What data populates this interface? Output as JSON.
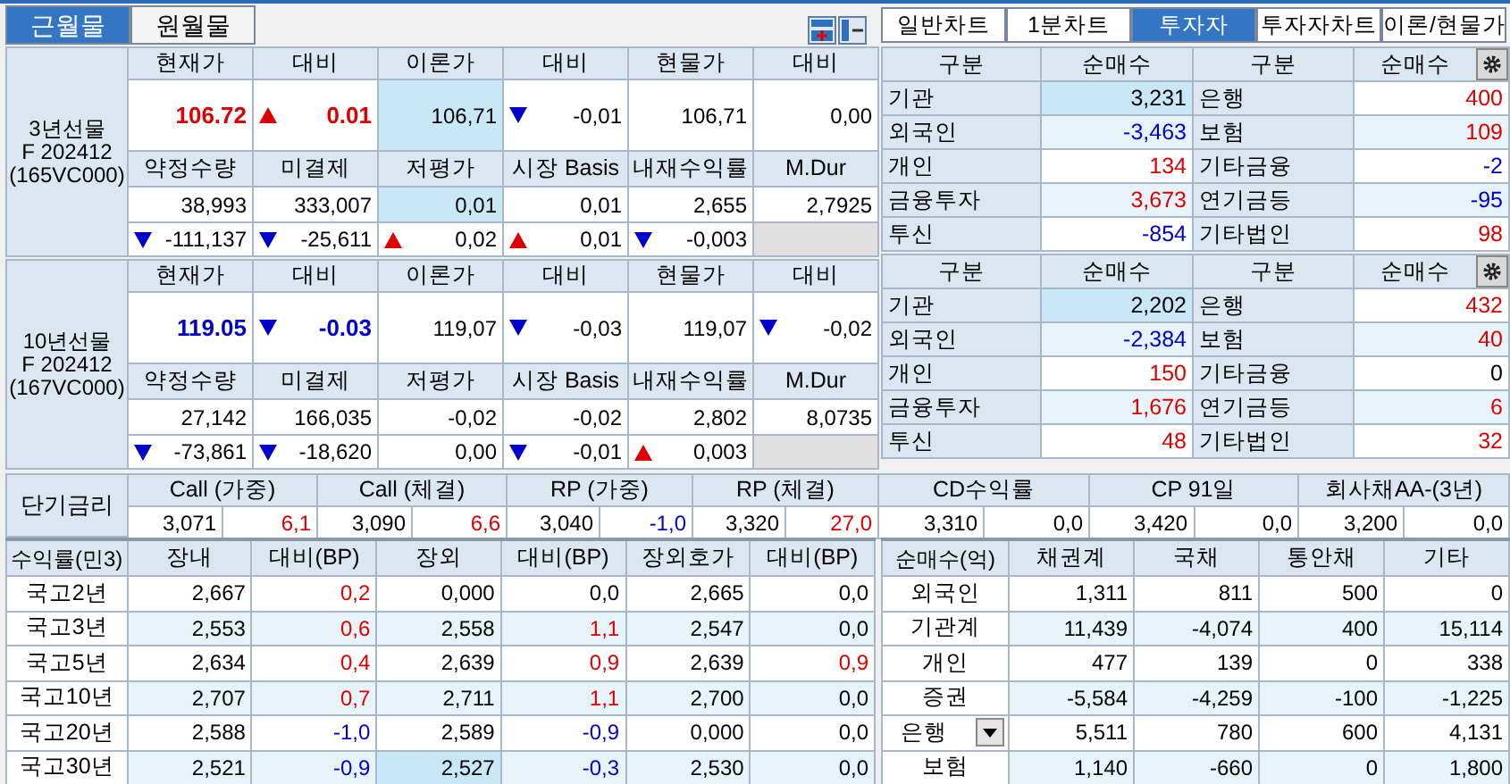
{
  "month_tabs": [
    {
      "label": "근월물",
      "selected": true
    },
    {
      "label": "원월물",
      "selected": false
    }
  ],
  "chart_tabs": [
    {
      "label": "일반차트",
      "selected": false
    },
    {
      "label": "1분차트",
      "selected": false
    },
    {
      "label": "투자자",
      "selected": true
    },
    {
      "label": "투자자차트",
      "selected": false
    },
    {
      "label": "이론/현물가",
      "selected": false
    }
  ],
  "futures": [
    {
      "name_lines": [
        "3년선물",
        "F 202412",
        "(165VC000)"
      ],
      "header1": [
        "현재가",
        "대비",
        "이론가",
        "대비",
        "현물가",
        "대비"
      ],
      "row1": [
        {
          "text": "106.72",
          "color": "#dd0000",
          "bold": true
        },
        {
          "text": "0.01",
          "color": "#dd0000",
          "bold": true,
          "rising": true
        },
        {
          "text": "106,71",
          "highlighted": true
        },
        {
          "text": "-0,01",
          "rising": false
        },
        {
          "text": "106,71"
        },
        {
          "text": "0,00"
        }
      ],
      "header2": [
        "약정수량",
        "미결제",
        "저평가",
        "시장 Basis",
        "내재수익률",
        "M.Dur"
      ],
      "row2": [
        {
          "text": "38,993"
        },
        {
          "text": "333,007"
        },
        {
          "text": "0,01",
          "highlighted": true
        },
        {
          "text": "0,01"
        },
        {
          "text": "2,655"
        },
        {
          "text": "2,7925"
        }
      ],
      "row3": [
        {
          "text": "-111,137",
          "rising": false
        },
        {
          "text": "-25,611",
          "rising": false
        },
        {
          "text": "0,02",
          "rising": true
        },
        {
          "text": "0,01",
          "rising": true
        },
        {
          "text": "-0,003",
          "rising": false
        }
      ]
    },
    {
      "name_lines": [
        "10년선물",
        "F 202412",
        "(167VC000)"
      ],
      "header1": [
        "현재가",
        "대비",
        "이론가",
        "대비",
        "현물가",
        "대비"
      ],
      "row1": [
        {
          "text": "119.05",
          "color": "#0000cc",
          "bold": true
        },
        {
          "text": "-0.03",
          "color": "#0000cc",
          "bold": true,
          "rising": false
        },
        {
          "text": "119,07"
        },
        {
          "text": "-0,03",
          "rising": false
        },
        {
          "text": "119,07"
        },
        {
          "text": "-0,02",
          "rising": false
        }
      ],
      "header2": [
        "약정수량",
        "미결제",
        "저평가",
        "시장 Basis",
        "내재수익률",
        "M.Dur"
      ],
      "row2": [
        {
          "text": "27,142"
        },
        {
          "text": "166,035"
        },
        {
          "text": "-0,02"
        },
        {
          "text": "-0,02"
        },
        {
          "text": "2,802"
        },
        {
          "text": "8,0735"
        }
      ],
      "row3": [
        {
          "text": "-73,861",
          "rising": false
        },
        {
          "text": "-18,620",
          "rising": false
        },
        {
          "text": "0,00"
        },
        {
          "text": "-0,01",
          "rising": false
        },
        {
          "text": "0,003",
          "rising": true
        }
      ]
    }
  ],
  "investor_tables": [
    {
      "headers": [
        "구분",
        "순매수",
        "구분",
        "순매수"
      ],
      "rows": [
        [
          {
            "label": "기관",
            "value": "3,231",
            "highlighted": true
          },
          {
            "label": "은행",
            "value": "400",
            "color": "#dd0000"
          }
        ],
        [
          {
            "label": "외국인",
            "value": "-3,463",
            "color": "#0000cc"
          },
          {
            "label": "보험",
            "value": "109",
            "color": "#dd0000"
          }
        ],
        [
          {
            "label": "개인",
            "value": "134",
            "color": "#dd0000"
          },
          {
            "label": "기타금융",
            "value": "-2",
            "color": "#0000cc"
          }
        ],
        [
          {
            "label": "금융투자",
            "value": "3,673",
            "color": "#dd0000"
          },
          {
            "label": "연기금등",
            "value": "-95",
            "color": "#0000cc"
          }
        ],
        [
          {
            "label": "투신",
            "value": "-854",
            "color": "#0000cc"
          },
          {
            "label": "기타법인",
            "value": "98",
            "color": "#dd0000"
          }
        ]
      ]
    },
    {
      "headers": [
        "구분",
        "순매수",
        "구분",
        "순매수"
      ],
      "rows": [
        [
          {
            "label": "기관",
            "value": "2,202",
            "highlighted": true
          },
          {
            "label": "은행",
            "value": "432",
            "color": "#dd0000"
          }
        ],
        [
          {
            "label": "외국인",
            "value": "-2,384",
            "color": "#0000cc"
          },
          {
            "label": "보험",
            "value": "40",
            "color": "#dd0000"
          }
        ],
        [
          {
            "label": "개인",
            "value": "150",
            "color": "#dd0000"
          },
          {
            "label": "기타금융",
            "value": "0"
          }
        ],
        [
          {
            "label": "금융투자",
            "value": "1,676",
            "color": "#dd0000"
          },
          {
            "label": "연기금등",
            "value": "6",
            "color": "#dd0000"
          }
        ],
        [
          {
            "label": "투신",
            "value": "48",
            "color": "#dd0000"
          },
          {
            "label": "기타법인",
            "value": "32",
            "color": "#dd0000"
          }
        ]
      ]
    }
  ],
  "short_rates": {
    "label": "단기금리",
    "groups": [
      {
        "name": "Call (가중)",
        "rate": "3,071",
        "change": "6,1",
        "color": "#dd0000"
      },
      {
        "name": "Call (체결)",
        "rate": "3,090",
        "change": "6,6",
        "color": "#dd0000"
      },
      {
        "name": "RP (가중)",
        "rate": "3,040",
        "change": "-1,0",
        "color": "#0000cc"
      },
      {
        "name": "RP (체결)",
        "rate": "3,320",
        "change": "27,0",
        "color": "#dd0000"
      },
      {
        "name": "CD수익률",
        "rate": "3,310",
        "change": "0,0"
      },
      {
        "name": "CP 91일",
        "rate": "3,420",
        "change": "0,0"
      },
      {
        "name": "회사채AA-(3년)",
        "rate": "3,200",
        "change": "0,0"
      }
    ]
  },
  "yield_table": {
    "corner": "수익률(민3)",
    "columns": [
      "장내",
      "대비(BP)",
      "장외",
      "대비(BP)",
      "장외호가",
      "대비(BP)"
    ],
    "rows": [
      {
        "label": "국고2년",
        "cells": [
          {
            "text": "2,667"
          },
          {
            "text": "0,2",
            "color": "#dd0000"
          },
          {
            "text": "0,000"
          },
          {
            "text": "0,0"
          },
          {
            "text": "2,665"
          },
          {
            "text": "0,0"
          }
        ]
      },
      {
        "label": "국고3년",
        "cells": [
          {
            "text": "2,553"
          },
          {
            "text": "0,6",
            "color": "#dd0000"
          },
          {
            "text": "2,558"
          },
          {
            "text": "1,1",
            "color": "#dd0000"
          },
          {
            "text": "2,547"
          },
          {
            "text": "0,0"
          }
        ]
      },
      {
        "label": "국고5년",
        "cells": [
          {
            "text": "2,634"
          },
          {
            "text": "0,4",
            "color": "#dd0000"
          },
          {
            "text": "2,639"
          },
          {
            "text": "0,9",
            "color": "#dd0000"
          },
          {
            "text": "2,639"
          },
          {
            "text": "0,9",
            "color": "#dd0000"
          }
        ]
      },
      {
        "label": "국고10년",
        "cells": [
          {
            "text": "2,707"
          },
          {
            "text": "0,7",
            "color": "#dd0000"
          },
          {
            "text": "2,711"
          },
          {
            "text": "1,1",
            "color": "#dd0000"
          },
          {
            "text": "2,700"
          },
          {
            "text": "0,0"
          }
        ]
      },
      {
        "label": "국고20년",
        "cells": [
          {
            "text": "2,588"
          },
          {
            "text": "-1,0",
            "color": "#0000cc"
          },
          {
            "text": "2,589"
          },
          {
            "text": "-0,9",
            "color": "#0000cc"
          },
          {
            "text": "0,000"
          },
          {
            "text": "0,0"
          }
        ]
      },
      {
        "label": "국고30년",
        "cells": [
          {
            "text": "2,521"
          },
          {
            "text": "-0,9",
            "color": "#0000cc"
          },
          {
            "text": "2,527",
            "highlighted": true
          },
          {
            "text": "-0,3",
            "color": "#0000cc"
          },
          {
            "text": "2,530"
          },
          {
            "text": "0,0"
          }
        ]
      }
    ]
  },
  "net_buying_table": {
    "corner": "순매수(억)",
    "columns": [
      "채권계",
      "국채",
      "통안채",
      "기타"
    ],
    "rows": [
      {
        "label": "외국인",
        "kind": "plain",
        "cells": [
          "1,311",
          "811",
          "500",
          "0"
        ]
      },
      {
        "label": "기관계",
        "kind": "plain",
        "cells": [
          "11,439",
          "-4,074",
          "400",
          "15,114"
        ]
      },
      {
        "label": "개인",
        "kind": "plain",
        "cells": [
          "477",
          "139",
          "0",
          "338"
        ]
      },
      {
        "label": "증권",
        "kind": "plain",
        "cells": [
          "-5,584",
          "-4,259",
          "-100",
          "-1,225"
        ]
      },
      {
        "label": "은행",
        "kind": "dropdown",
        "cells": [
          "5,511",
          "780",
          "600",
          "4,131"
        ]
      },
      {
        "label": "보험",
        "kind": "plain",
        "cells": [
          "1,140",
          "-660",
          "0",
          "1,800"
        ]
      }
    ]
  }
}
